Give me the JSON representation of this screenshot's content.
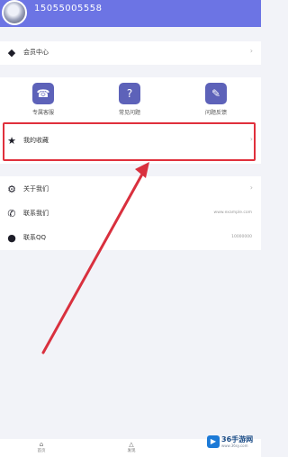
{
  "header": {
    "phone": "15055005558"
  },
  "member": {
    "label": "会员中心"
  },
  "quick_actions": [
    {
      "label": "专属客服",
      "icon": "customer-service-icon"
    },
    {
      "label": "常见问题",
      "icon": "faq-icon"
    },
    {
      "label": "问题反馈",
      "icon": "feedback-icon"
    }
  ],
  "favorites": {
    "label": "我的收藏"
  },
  "about": {
    "label": "关于我们"
  },
  "contact": {
    "label": "联系我们",
    "value": "www.example.com"
  },
  "qq": {
    "label": "联系QQ",
    "value": "10000000"
  },
  "tabs": [
    {
      "label": "首页",
      "icon": "home-icon"
    },
    {
      "label": "发现",
      "icon": "discover-icon"
    }
  ],
  "watermark": {
    "brand": "36手游网",
    "url": "www.36sy.com"
  },
  "colors": {
    "header": "#6c74e4",
    "highlight": "#e0303c",
    "tile": "#5d62b9"
  }
}
